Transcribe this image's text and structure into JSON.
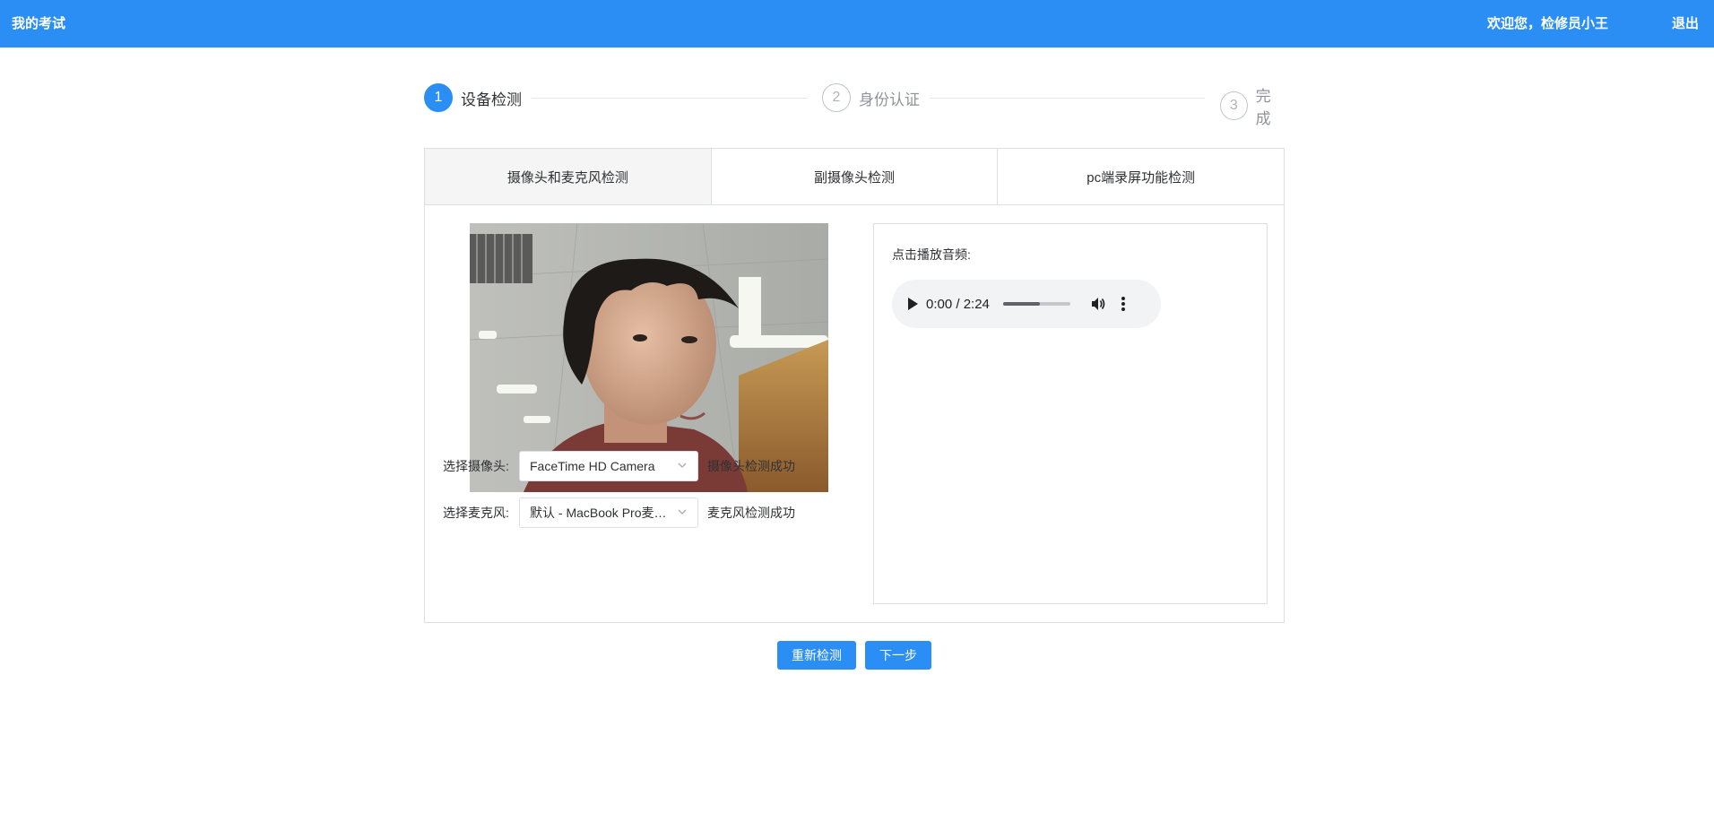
{
  "header": {
    "title": "我的考试",
    "welcome": "欢迎您，检修员小王",
    "logout": "退出",
    "color": "#2b8ef5"
  },
  "steps": [
    {
      "number": "1",
      "label": "设备检测",
      "active": true
    },
    {
      "number": "2",
      "label": "身份认证",
      "active": false
    },
    {
      "number": "3",
      "label": "完成",
      "active": false
    }
  ],
  "tabs": [
    {
      "label": "摄像头和麦克风检测",
      "active": true
    },
    {
      "label": "副摄像头检测",
      "active": false
    },
    {
      "label": "pc端录屏功能检测",
      "active": false
    }
  ],
  "camera": {
    "label": "选择摄像头:",
    "selected": "FaceTime HD Camera",
    "status": "摄像头检测成功"
  },
  "microphone": {
    "label": "选择麦克风:",
    "selected": "默认 - MacBook Pro麦克风 (Built-in)",
    "status": "麦克风检测成功"
  },
  "audio": {
    "hint": "点击播放音频:",
    "time": "0:00 / 2:24",
    "volume_level": 0.55,
    "icons": [
      "play-icon",
      "volume-icon",
      "more-vertical-icon"
    ]
  },
  "buttons": {
    "recheck": "重新检测",
    "next": "下一步"
  }
}
